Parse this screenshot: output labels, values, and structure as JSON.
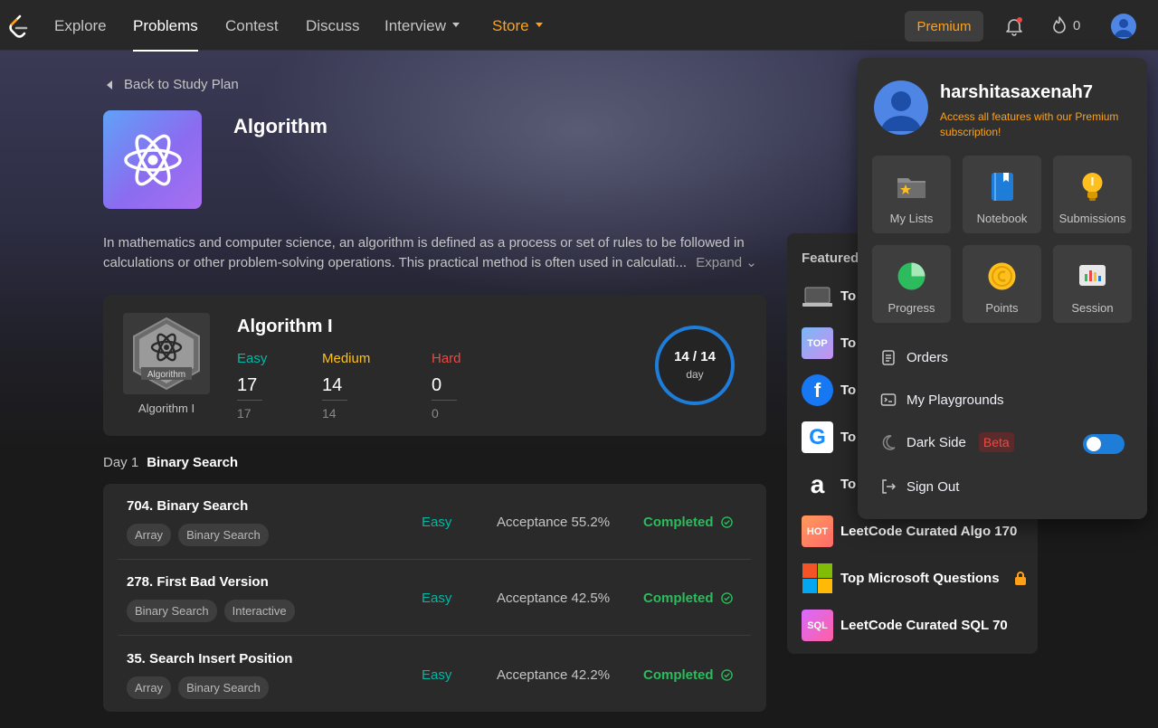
{
  "nav": {
    "links": [
      "Explore",
      "Problems",
      "Contest",
      "Discuss",
      "Interview",
      "Store"
    ],
    "premium_label": "Premium",
    "streak_count": "0",
    "accent": "#ffa116"
  },
  "main": {
    "back_label": "Back to Study Plan",
    "plan_title": "Algorithm",
    "description": "In mathematics and computer science, an algorithm is defined as a process or set of rules to be followed in calculations or other problem-solving operations. This practical method is often used in calculati...",
    "expand_label": "Expand",
    "card": {
      "badge_text": "Algorithm",
      "badge_caption": "Algorithm I",
      "title": "Algorithm I",
      "easy": {
        "label": "Easy",
        "value": "17",
        "total": "17",
        "color": "#00b8a3"
      },
      "medium": {
        "label": "Medium",
        "value": "14",
        "total": "14",
        "color": "#ffc01e"
      },
      "hard": {
        "label": "Hard",
        "value": "0",
        "total": "0",
        "color": "#ef4743"
      },
      "progress_text": "14 / 14",
      "progress_unit": "day",
      "progress_fraction": 1.0
    },
    "day_label": "Day 1",
    "day_topic": "Binary Search",
    "problems": [
      {
        "title": "704. Binary Search",
        "tags": [
          "Array",
          "Binary Search"
        ],
        "difficulty": "Easy",
        "acceptance": "Acceptance 55.2%",
        "status": "Completed"
      },
      {
        "title": "278. First Bad Version",
        "tags": [
          "Binary Search",
          "Interactive"
        ],
        "difficulty": "Easy",
        "acceptance": "Acceptance 42.5%",
        "status": "Completed"
      },
      {
        "title": "35. Search Insert Position",
        "tags": [
          "Array",
          "Binary Search"
        ],
        "difficulty": "Easy",
        "acceptance": "Acceptance 42.2%",
        "status": "Completed"
      }
    ]
  },
  "featured": {
    "title": "Featured",
    "items": [
      {
        "label": "To",
        "icon_text": "",
        "icon": "laptop-icon"
      },
      {
        "label": "To",
        "icon_text": "TOP",
        "icon": "top-badge-icon"
      },
      {
        "label": "To",
        "icon_text": "f",
        "icon": "facebook-icon"
      },
      {
        "label": "To",
        "icon_text": "G",
        "icon": "google-icon"
      },
      {
        "label": "To",
        "icon_text": "a",
        "icon": "amazon-icon"
      },
      {
        "label": "LeetCode Curated Algo 170",
        "icon_text": "HOT",
        "icon": "hot-icon"
      },
      {
        "label": "Top Microsoft Questions",
        "icon_text": "",
        "icon": "microsoft-icon"
      },
      {
        "label": "LeetCode Curated SQL 70",
        "icon_text": "SQL",
        "icon": "sql-icon"
      }
    ]
  },
  "dropdown": {
    "username": "harshitasaxenah7",
    "promo": "Access all features with our Premium subscription!",
    "tiles": [
      "My Lists",
      "Notebook",
      "Submissions",
      "Progress",
      "Points",
      "Session"
    ],
    "items": [
      "Orders",
      "My Playgrounds",
      "Dark Side",
      "Sign Out"
    ],
    "beta_label": "Beta",
    "dark_side_on": true
  }
}
